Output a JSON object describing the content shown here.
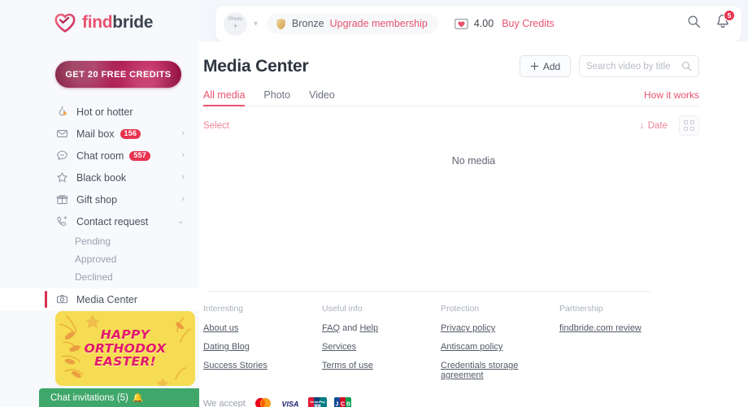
{
  "brand": {
    "find": "find",
    "bride": "bride",
    "heart_icon": "heart-logo-icon"
  },
  "sidebar": {
    "credits_cta": "GET 20 FREE CREDITS",
    "items": [
      {
        "label": "Hot or hotter",
        "icon": "flame-icon",
        "badge": null,
        "chevron": false
      },
      {
        "label": "Mail box",
        "icon": "envelope-icon",
        "badge": "156",
        "chevron": true
      },
      {
        "label": "Chat room",
        "icon": "chat-bubble-icon",
        "badge": "557",
        "chevron": true
      },
      {
        "label": "Black book",
        "icon": "star-icon",
        "badge": null,
        "chevron": true
      },
      {
        "label": "Gift shop",
        "icon": "gift-icon",
        "badge": null,
        "chevron": true
      },
      {
        "label": "Contact request",
        "icon": "phone-plus-icon",
        "badge": null,
        "chevron": true,
        "expanded": true
      }
    ],
    "sub_items": [
      "Pending",
      "Approved",
      "Declined"
    ],
    "active_item": {
      "label": "Media Center",
      "icon": "camera-icon"
    },
    "banner": {
      "line1": "HAPPY",
      "line2": "ORTHODOX",
      "line3": "EASTER!",
      "bg_color": "#f6dc52",
      "text_color": "#e3186d"
    },
    "chat_bar": {
      "label": "Chat invitations (5)",
      "bell_icon": "bell-icon",
      "collapse_icon": "chevron-up-icon",
      "color": "#3fa76a"
    }
  },
  "topbar": {
    "photo_button": {
      "line1": "Photo",
      "line2": "+"
    },
    "dropdown_icon": "chevron-down-icon",
    "membership": {
      "shield_icon": "shield-icon",
      "tier": "Bronze",
      "upgrade_label": "Upgrade membership"
    },
    "credits": {
      "icon": "credit-card-heart-icon",
      "value": "4.00",
      "buy_label": "Buy Credits"
    },
    "search_icon": "search-icon",
    "notifications": {
      "icon": "bell-icon",
      "count": "5"
    }
  },
  "page": {
    "title": "Media Center",
    "add_button": {
      "label": "Add",
      "icon": "plus-icon"
    },
    "search": {
      "placeholder": "Search video by title",
      "value": "",
      "icon": "search-icon"
    },
    "tabs": [
      {
        "label": "All media",
        "active": true
      },
      {
        "label": "Photo",
        "active": false
      },
      {
        "label": "Video",
        "active": false
      }
    ],
    "how_it_works": "How it works",
    "select_label": "Select",
    "sort": {
      "label": "Date",
      "icon": "arrow-down-icon"
    },
    "view_toggle_icon": "grid-view-icon",
    "empty_state": "No media"
  },
  "footer": {
    "columns": [
      {
        "heading": "Interesting",
        "links": [
          "About us",
          "Dating Blog",
          "Success Stories"
        ]
      },
      {
        "heading": "Useful info",
        "links": [
          "FAQ and Help",
          "Services",
          "Terms of use"
        ]
      },
      {
        "heading": "Protection",
        "links": [
          "Privacy policy",
          "Antiscam policy",
          "Credentials storage agreement"
        ]
      },
      {
        "heading": "Partnership",
        "links": [
          "findbride.com review"
        ]
      }
    ],
    "faq_parts": {
      "faq": "FAQ",
      "and": " and ",
      "help": "Help"
    },
    "payments": {
      "label": "We accept",
      "cards": [
        "mastercard-icon",
        "visa-icon",
        "unionpay-icon",
        "jcb-icon"
      ]
    }
  },
  "colors": {
    "accent": "#e8536f",
    "badge": "#e8334f",
    "green": "#3fa76a",
    "banner_yellow": "#f6dc52"
  }
}
